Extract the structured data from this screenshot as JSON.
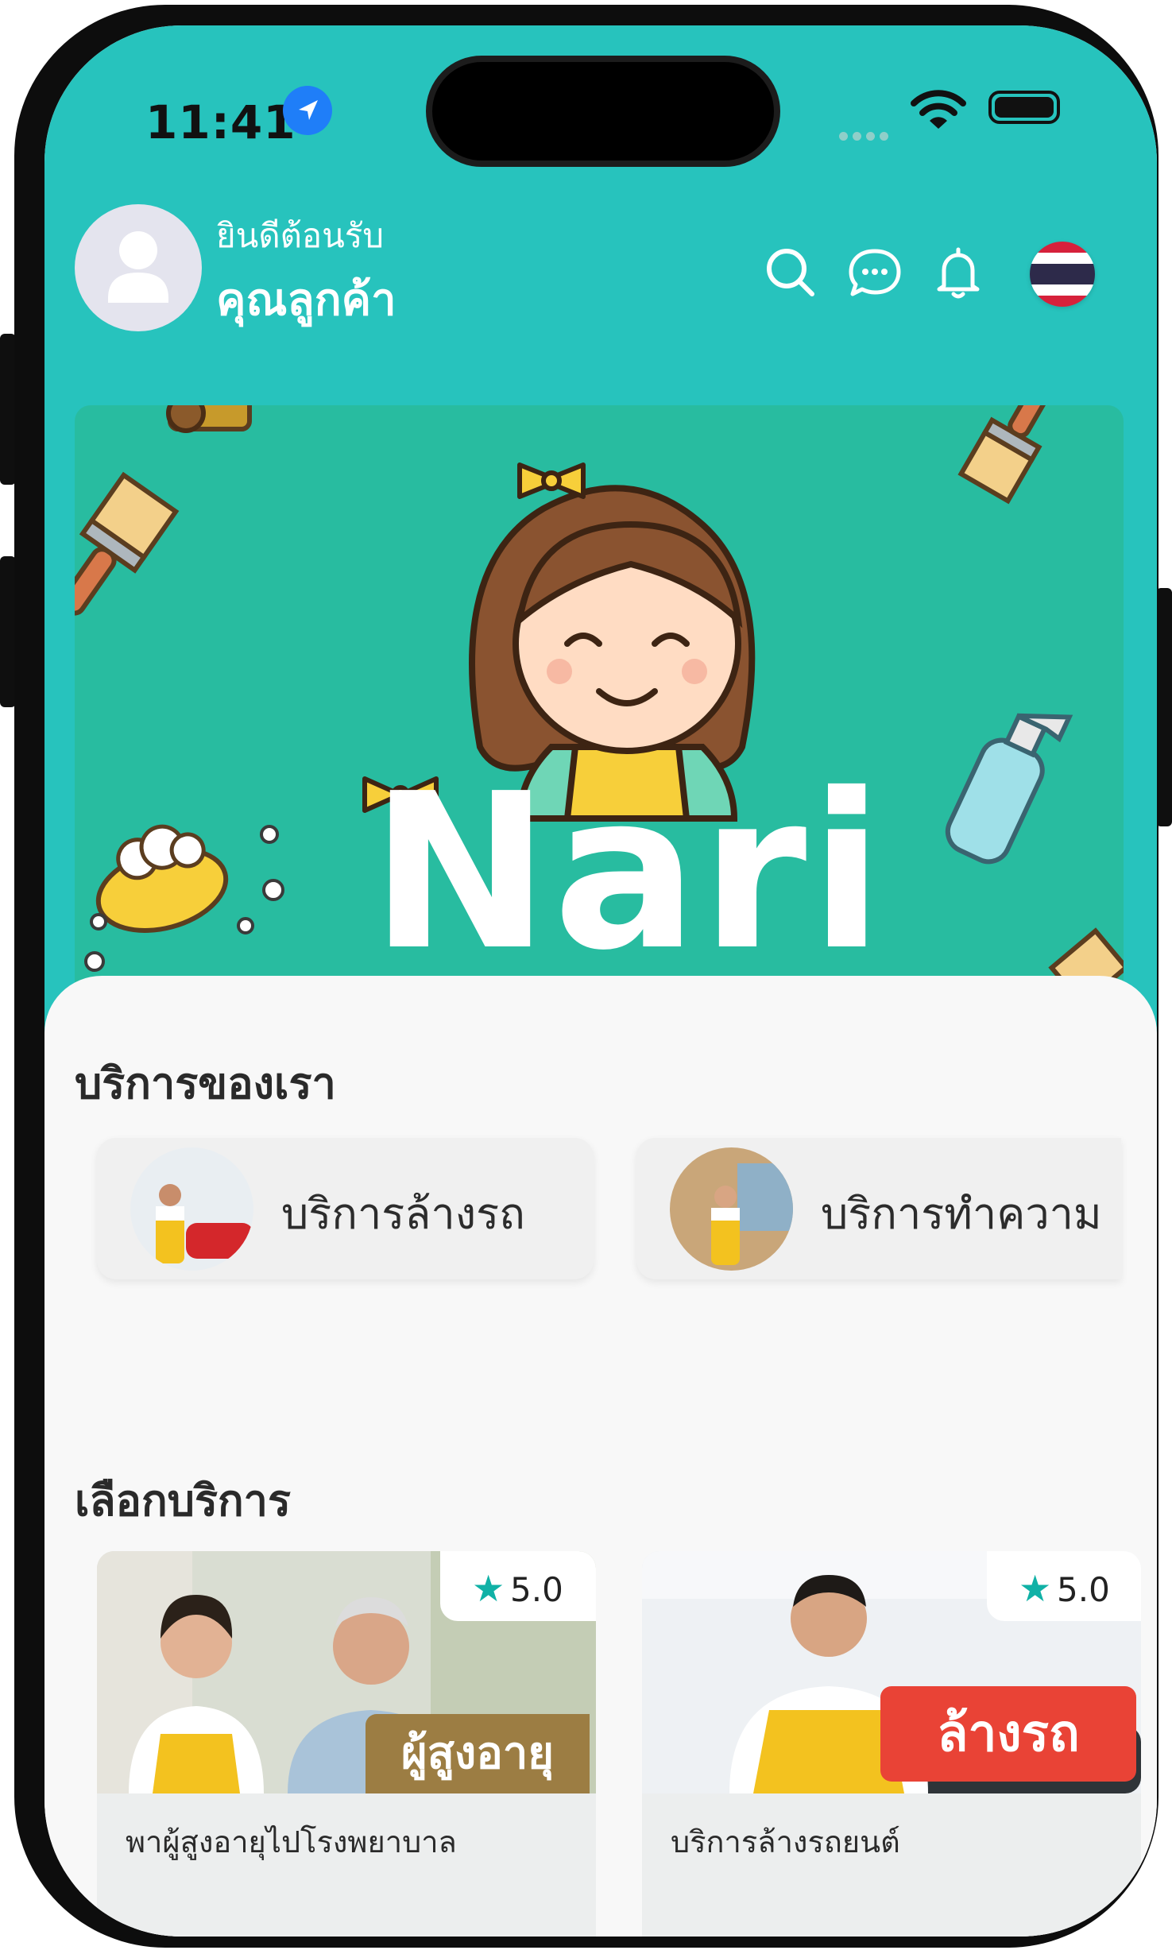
{
  "status_bar": {
    "time": "11:41"
  },
  "header": {
    "greeting": "ยินดีต้อนรับ",
    "name": "คุณลูกค้า",
    "icons": [
      "search-icon",
      "chat-icon",
      "bell-icon",
      "thai-flag-icon"
    ]
  },
  "banner": {
    "logo_text": "Nari"
  },
  "services": {
    "title": "บริการของเรา",
    "items": [
      {
        "label": "บริการล้างรถ"
      },
      {
        "label": "บริการทำความ"
      }
    ]
  },
  "choices": {
    "title": "เลือกบริการ",
    "items": [
      {
        "rating": "5.0",
        "tag": "ผู้สูงอายุ",
        "label": "พาผู้สูงอายุไปโรงพยาบาล"
      },
      {
        "rating": "5.0",
        "tag": "ล้างรถ",
        "label": "บริการล้างรถยนต์"
      }
    ]
  },
  "colors": {
    "header_teal": "#27c3bd",
    "banner_green": "#28bca0",
    "star": "#10b1a6",
    "car_tag": "#e94336",
    "elder_tag": "#9c7d43"
  }
}
